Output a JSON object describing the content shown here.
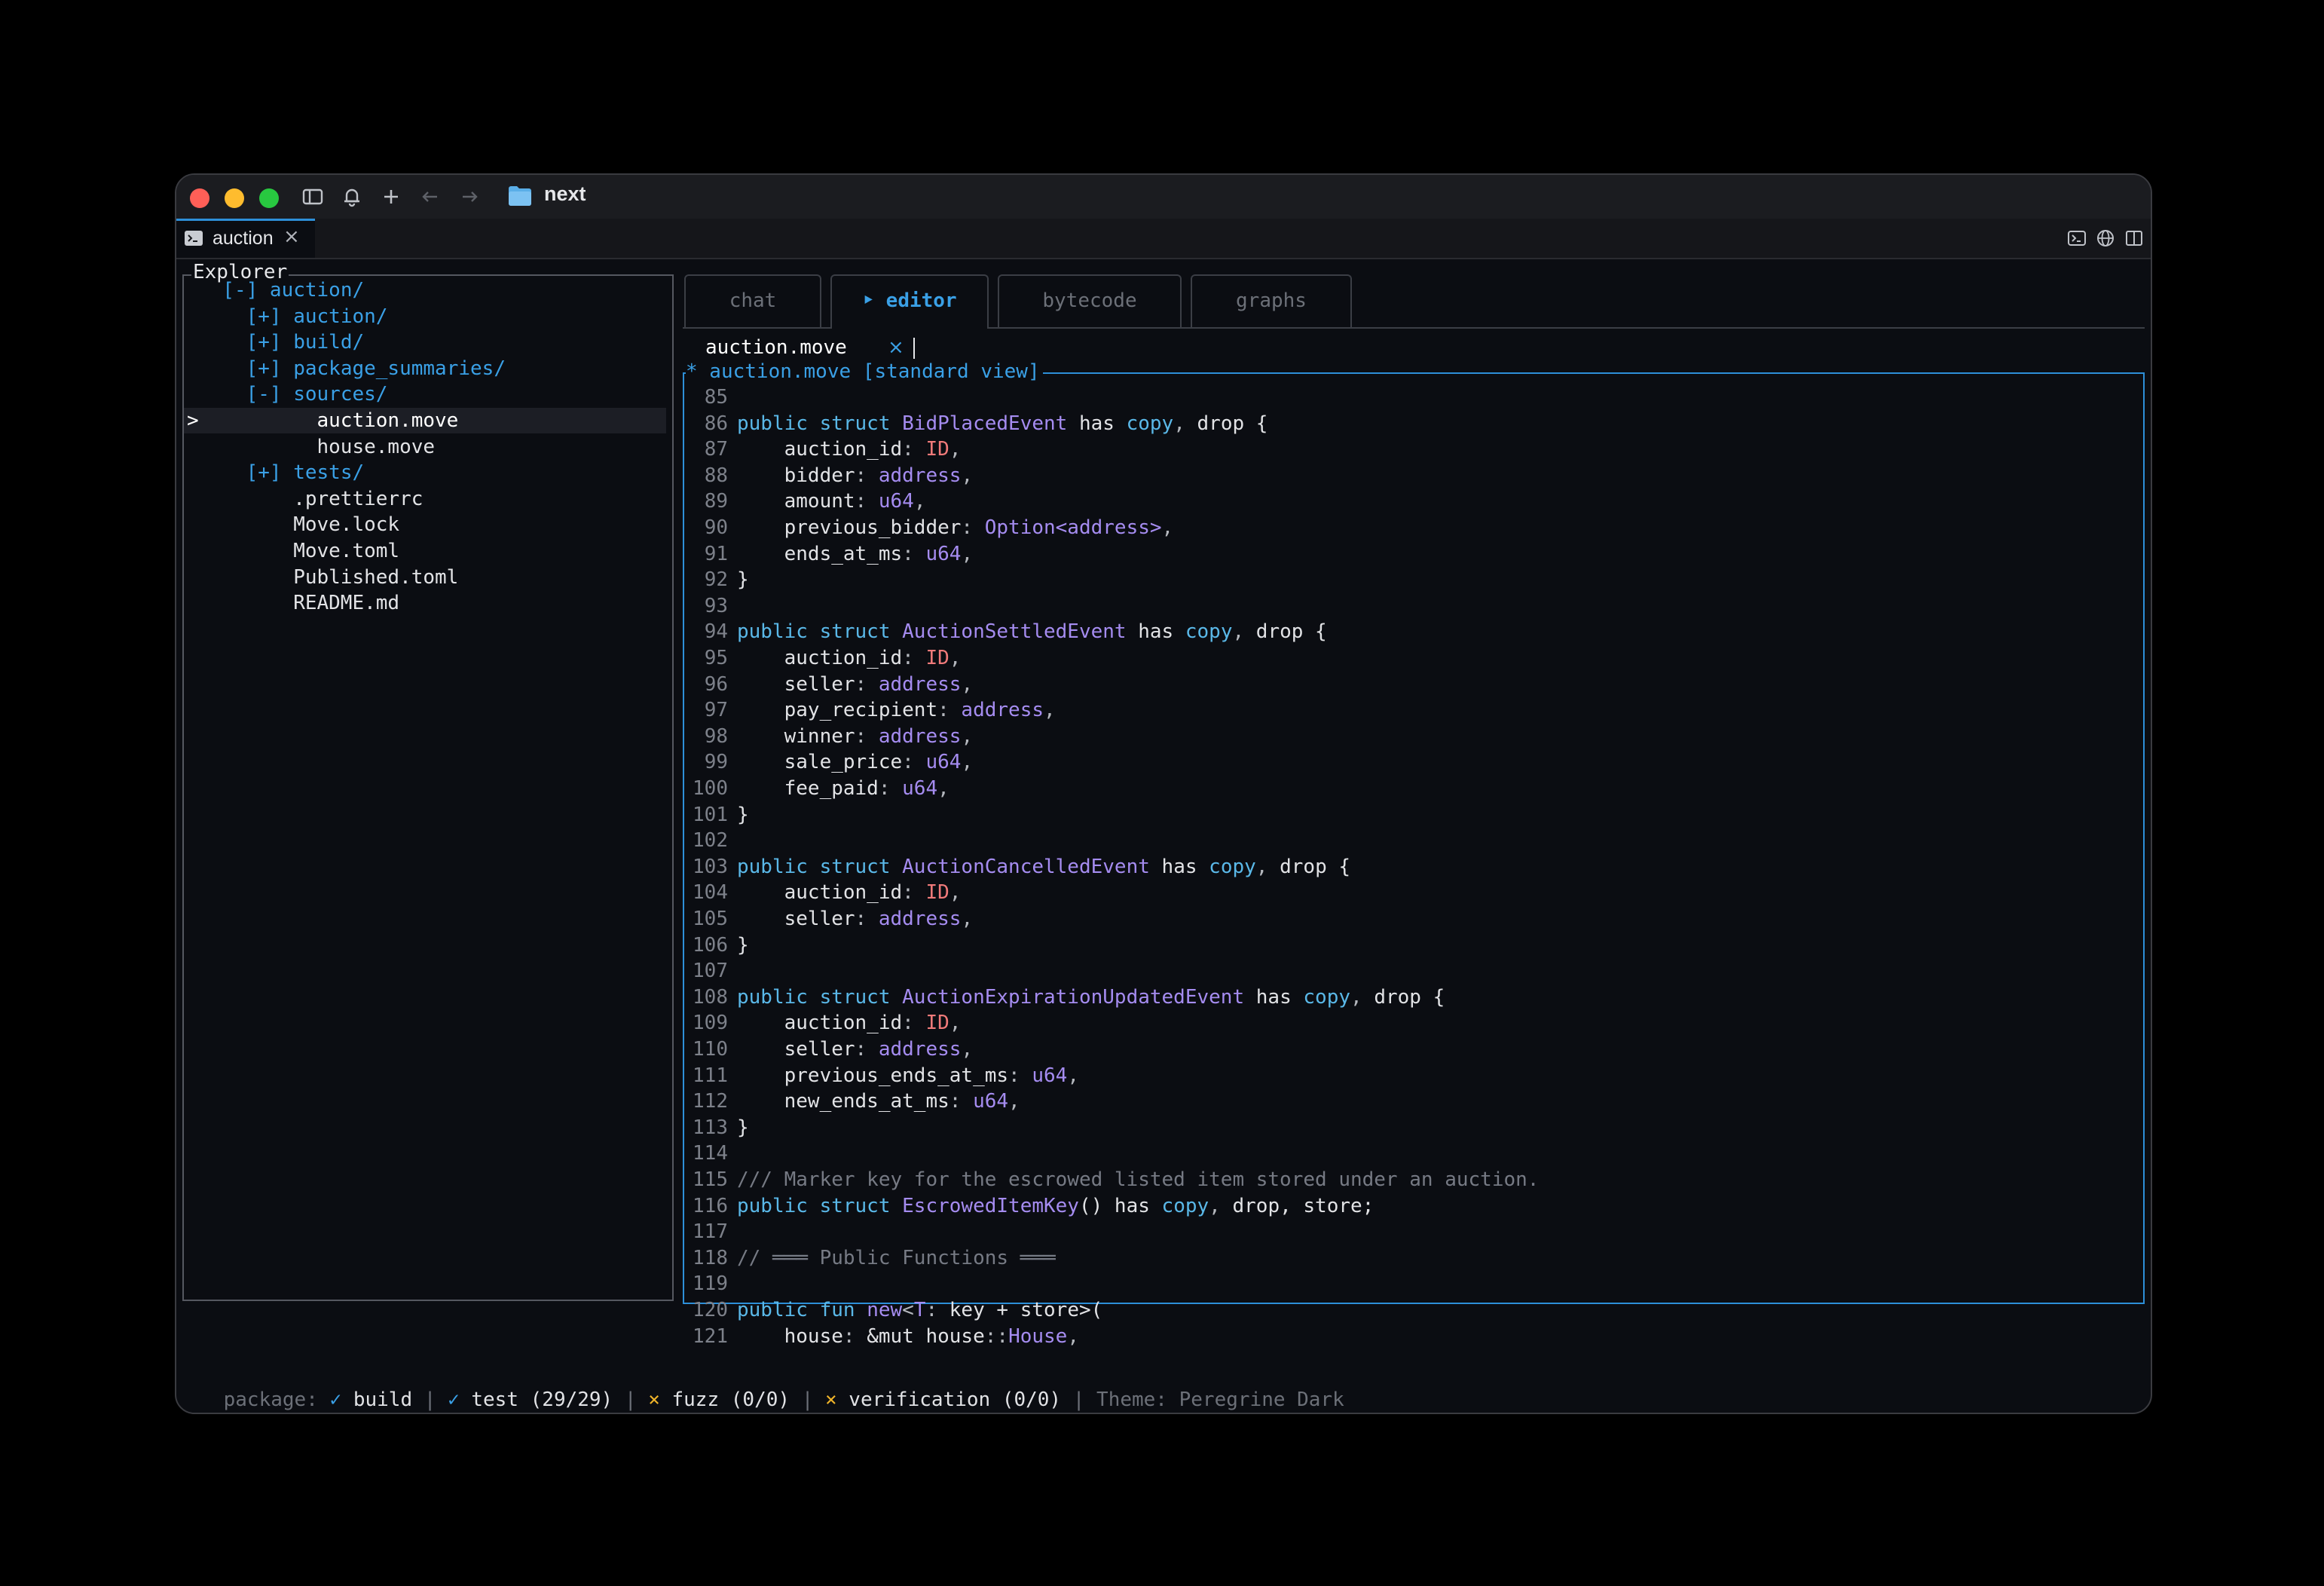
{
  "window": {
    "title": "next",
    "tab": {
      "label": "auction",
      "close": "×"
    }
  },
  "explorer": {
    "title": "Explorer",
    "selected_marker": ">",
    "items": [
      {
        "text": "[-] auction/",
        "kind": "dir",
        "indent": 1
      },
      {
        "text": "[+] auction/",
        "kind": "dir",
        "indent": 2
      },
      {
        "text": "[+] build/",
        "kind": "dir",
        "indent": 2
      },
      {
        "text": "[+] package_summaries/",
        "kind": "dir",
        "indent": 2
      },
      {
        "text": "[-] sources/",
        "kind": "dir",
        "indent": 2
      },
      {
        "text": "auction.move",
        "kind": "file",
        "indent": 5,
        "selected": true
      },
      {
        "text": "house.move",
        "kind": "file",
        "indent": 5
      },
      {
        "text": "[+] tests/",
        "kind": "dir",
        "indent": 2
      },
      {
        "text": ".prettierrc",
        "kind": "file",
        "indent": 4
      },
      {
        "text": "Move.lock",
        "kind": "file",
        "indent": 4
      },
      {
        "text": "Move.toml",
        "kind": "file",
        "indent": 4
      },
      {
        "text": "Published.toml",
        "kind": "file",
        "indent": 4
      },
      {
        "text": "README.md",
        "kind": "file",
        "indent": 4
      }
    ]
  },
  "main_tabs": [
    {
      "label": "chat",
      "active": false
    },
    {
      "label": "‣ editor",
      "active": true
    },
    {
      "label": "bytecode",
      "active": false
    },
    {
      "label": "graphs",
      "active": false
    }
  ],
  "editor": {
    "file_tab": {
      "label": "auction.move",
      "close": "×"
    },
    "pane_title": "* auction.move [standard view]",
    "lines": [
      {
        "n": "85",
        "t": []
      },
      {
        "n": "86",
        "t": [
          [
            "kw",
            "public struct "
          ],
          [
            "ty",
            "BidPlacedEvent"
          ],
          [
            "pl",
            " has "
          ],
          [
            "kw",
            "copy"
          ],
          [
            "pu",
            ","
          ],
          [
            "pl",
            " drop {"
          ]
        ]
      },
      {
        "n": "87",
        "t": [
          [
            "pl",
            "    auction_id"
          ],
          [
            "pu",
            ": "
          ],
          [
            "id",
            "ID"
          ],
          [
            "pu",
            ","
          ]
        ]
      },
      {
        "n": "88",
        "t": [
          [
            "pl",
            "    bidder"
          ],
          [
            "pu",
            ": "
          ],
          [
            "ty",
            "address"
          ],
          [
            "pu",
            ","
          ]
        ]
      },
      {
        "n": "89",
        "t": [
          [
            "pl",
            "    amount"
          ],
          [
            "pu",
            ": "
          ],
          [
            "ty",
            "u64"
          ],
          [
            "pu",
            ","
          ]
        ]
      },
      {
        "n": "90",
        "t": [
          [
            "pl",
            "    previous_bidder"
          ],
          [
            "pu",
            ": "
          ],
          [
            "ty",
            "Option<address>"
          ],
          [
            "pu",
            ","
          ]
        ]
      },
      {
        "n": "91",
        "t": [
          [
            "pl",
            "    ends_at_ms"
          ],
          [
            "pu",
            ": "
          ],
          [
            "ty",
            "u64"
          ],
          [
            "pu",
            ","
          ]
        ]
      },
      {
        "n": "92",
        "t": [
          [
            "pl",
            "}"
          ]
        ]
      },
      {
        "n": "93",
        "t": []
      },
      {
        "n": "94",
        "t": [
          [
            "kw",
            "public struct "
          ],
          [
            "ty",
            "AuctionSettledEvent"
          ],
          [
            "pl",
            " has "
          ],
          [
            "kw",
            "copy"
          ],
          [
            "pu",
            ","
          ],
          [
            "pl",
            " drop {"
          ]
        ]
      },
      {
        "n": "95",
        "t": [
          [
            "pl",
            "    auction_id"
          ],
          [
            "pu",
            ": "
          ],
          [
            "id",
            "ID"
          ],
          [
            "pu",
            ","
          ]
        ]
      },
      {
        "n": "96",
        "t": [
          [
            "pl",
            "    seller"
          ],
          [
            "pu",
            ": "
          ],
          [
            "ty",
            "address"
          ],
          [
            "pu",
            ","
          ]
        ]
      },
      {
        "n": "97",
        "t": [
          [
            "pl",
            "    pay_recipient"
          ],
          [
            "pu",
            ": "
          ],
          [
            "ty",
            "address"
          ],
          [
            "pu",
            ","
          ]
        ]
      },
      {
        "n": "98",
        "t": [
          [
            "pl",
            "    winner"
          ],
          [
            "pu",
            ": "
          ],
          [
            "ty",
            "address"
          ],
          [
            "pu",
            ","
          ]
        ]
      },
      {
        "n": "99",
        "t": [
          [
            "pl",
            "    sale_price"
          ],
          [
            "pu",
            ": "
          ],
          [
            "ty",
            "u64"
          ],
          [
            "pu",
            ","
          ]
        ]
      },
      {
        "n": "100",
        "t": [
          [
            "pl",
            "    fee_paid"
          ],
          [
            "pu",
            ": "
          ],
          [
            "ty",
            "u64"
          ],
          [
            "pu",
            ","
          ]
        ]
      },
      {
        "n": "101",
        "t": [
          [
            "pl",
            "}"
          ]
        ]
      },
      {
        "n": "102",
        "t": []
      },
      {
        "n": "103",
        "t": [
          [
            "kw",
            "public struct "
          ],
          [
            "ty",
            "AuctionCancelledEvent"
          ],
          [
            "pl",
            " has "
          ],
          [
            "kw",
            "copy"
          ],
          [
            "pu",
            ","
          ],
          [
            "pl",
            " drop {"
          ]
        ]
      },
      {
        "n": "104",
        "t": [
          [
            "pl",
            "    auction_id"
          ],
          [
            "pu",
            ": "
          ],
          [
            "id",
            "ID"
          ],
          [
            "pu",
            ","
          ]
        ]
      },
      {
        "n": "105",
        "t": [
          [
            "pl",
            "    seller"
          ],
          [
            "pu",
            ": "
          ],
          [
            "ty",
            "address"
          ],
          [
            "pu",
            ","
          ]
        ]
      },
      {
        "n": "106",
        "t": [
          [
            "pl",
            "}"
          ]
        ]
      },
      {
        "n": "107",
        "t": []
      },
      {
        "n": "108",
        "t": [
          [
            "kw",
            "public struct "
          ],
          [
            "ty",
            "AuctionExpirationUpdatedEvent"
          ],
          [
            "pl",
            " has "
          ],
          [
            "kw",
            "copy"
          ],
          [
            "pu",
            ","
          ],
          [
            "pl",
            " drop {"
          ]
        ]
      },
      {
        "n": "109",
        "t": [
          [
            "pl",
            "    auction_id"
          ],
          [
            "pu",
            ": "
          ],
          [
            "id",
            "ID"
          ],
          [
            "pu",
            ","
          ]
        ]
      },
      {
        "n": "110",
        "t": [
          [
            "pl",
            "    seller"
          ],
          [
            "pu",
            ": "
          ],
          [
            "ty",
            "address"
          ],
          [
            "pu",
            ","
          ]
        ]
      },
      {
        "n": "111",
        "t": [
          [
            "pl",
            "    previous_ends_at_ms"
          ],
          [
            "pu",
            ": "
          ],
          [
            "ty",
            "u64"
          ],
          [
            "pu",
            ","
          ]
        ]
      },
      {
        "n": "112",
        "t": [
          [
            "pl",
            "    new_ends_at_ms"
          ],
          [
            "pu",
            ": "
          ],
          [
            "ty",
            "u64"
          ],
          [
            "pu",
            ","
          ]
        ]
      },
      {
        "n": "113",
        "t": [
          [
            "pl",
            "}"
          ]
        ]
      },
      {
        "n": "114",
        "t": []
      },
      {
        "n": "115",
        "t": [
          [
            "cm",
            "/// Marker key for the escrowed listed item stored under an auction."
          ]
        ]
      },
      {
        "n": "116",
        "t": [
          [
            "kw",
            "public struct "
          ],
          [
            "ty",
            "EscrowedItemKey"
          ],
          [
            "pl",
            "() has "
          ],
          [
            "kw",
            "copy"
          ],
          [
            "pu",
            ","
          ],
          [
            "pl",
            " drop, store;"
          ]
        ]
      },
      {
        "n": "117",
        "t": []
      },
      {
        "n": "118",
        "t": [
          [
            "cm",
            "// ═══ Public Functions ═══"
          ]
        ]
      },
      {
        "n": "119",
        "t": []
      },
      {
        "n": "120",
        "t": [
          [
            "kw",
            "public fun "
          ],
          [
            "ty",
            "new"
          ],
          [
            "pu",
            "<"
          ],
          [
            "ty",
            "T"
          ],
          [
            "pu",
            ": "
          ],
          [
            "pl",
            "key + store>("
          ]
        ]
      },
      {
        "n": "121",
        "t": [
          [
            "pl",
            "    house"
          ],
          [
            "pu",
            ": "
          ],
          [
            "pl",
            "&mut house"
          ],
          [
            "pu",
            "::"
          ],
          [
            "ty",
            "House"
          ],
          [
            "pu",
            ","
          ]
        ]
      }
    ]
  },
  "status": [
    [
      "gray",
      "package: "
    ],
    [
      "ok",
      "✓"
    ],
    [
      "white",
      " build "
    ],
    [
      "gray",
      "| "
    ],
    [
      "ok",
      "✓"
    ],
    [
      "white",
      " test (29/29) "
    ],
    [
      "gray",
      "| "
    ],
    [
      "x",
      "×"
    ],
    [
      "white",
      " fuzz (0/0) "
    ],
    [
      "gray",
      "| "
    ],
    [
      "x",
      "×"
    ],
    [
      "white",
      " verification (0/0) "
    ],
    [
      "gray",
      "| Theme: Peregrine Dark"
    ]
  ]
}
